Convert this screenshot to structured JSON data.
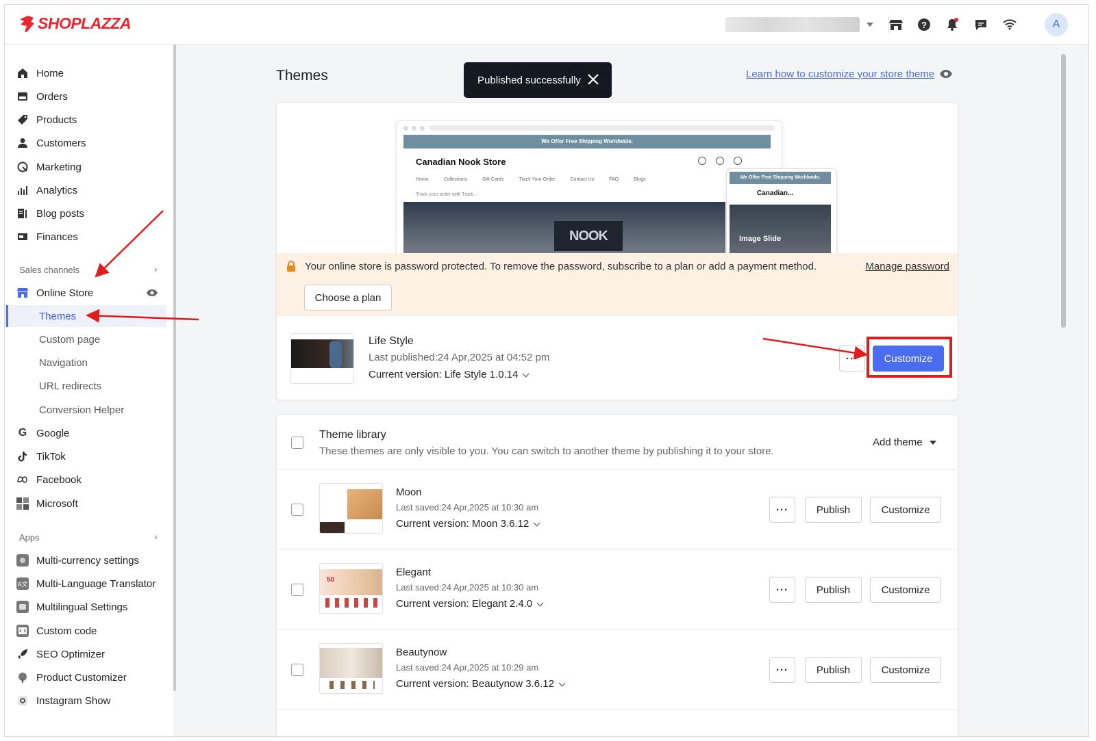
{
  "brand": {
    "name": "SHOPLAZZA",
    "color": "#e8262b"
  },
  "header": {
    "icons": [
      "store-icon",
      "help-icon",
      "bell-icon",
      "chat-icon",
      "wifi-icon"
    ],
    "avatar": "A"
  },
  "sidebar": {
    "items": [
      {
        "label": "Home",
        "icon": "home-icon"
      },
      {
        "label": "Orders",
        "icon": "orders-icon"
      },
      {
        "label": "Products",
        "icon": "tag-icon"
      },
      {
        "label": "Customers",
        "icon": "person-icon"
      },
      {
        "label": "Marketing",
        "icon": "marketing-icon"
      },
      {
        "label": "Analytics",
        "icon": "analytics-icon"
      },
      {
        "label": "Blog posts",
        "icon": "blog-icon"
      },
      {
        "label": "Finances",
        "icon": "finances-icon"
      }
    ],
    "sales_channels_title": "Sales channels",
    "online_store": "Online Store",
    "sub_items": [
      "Themes",
      "Custom page",
      "Navigation",
      "URL redirects",
      "Conversion Helper"
    ],
    "channels": [
      {
        "label": "Google",
        "icon": "google-icon"
      },
      {
        "label": "TikTok",
        "icon": "tiktok-icon"
      },
      {
        "label": "Facebook",
        "icon": "meta-icon"
      },
      {
        "label": "Microsoft",
        "icon": "microsoft-icon"
      }
    ],
    "apps_title": "Apps",
    "apps": [
      {
        "label": "Multi-currency settings",
        "icon": "currency-app-icon"
      },
      {
        "label": "Multi-Language Translator",
        "icon": "translator-app-icon"
      },
      {
        "label": "Multilingual Settings",
        "icon": "multilingual-app-icon"
      },
      {
        "label": "Custom code",
        "icon": "code-app-icon"
      },
      {
        "label": "SEO Optimizer",
        "icon": "rocket-app-icon"
      },
      {
        "label": "Product Customizer",
        "icon": "customizer-app-icon"
      },
      {
        "label": "Instagram Show",
        "icon": "instagram-app-icon"
      }
    ]
  },
  "page": {
    "title": "Themes",
    "toast": "Published successfully",
    "learn_link": "Learn how to customize your store theme"
  },
  "preview": {
    "banner": "We Offer Free Shipping Worldwide.",
    "store_name": "Canadian Nook Store",
    "nav": [
      "Home",
      "Collections",
      "Gift Cards",
      "Track Your Order",
      "Contact Us",
      "FAQ",
      "Blogs"
    ],
    "track": "Track your order with Track...",
    "hero_sign": "NOOK STORE",
    "mobile_title": "Canadian...",
    "mobile_hero": "Image Slide"
  },
  "warning": {
    "text": "Your online store is password protected. To remove the password, subscribe to a plan or add a payment method.",
    "link": "Manage password",
    "button": "Choose a plan"
  },
  "current_theme": {
    "name": "Life Style",
    "last_published": "Last published:24 Apr,2025 at 04:52 pm",
    "version": "Current version: Life Style 1.0.14",
    "more": "···",
    "customize": "Customize"
  },
  "library": {
    "title": "Theme library",
    "subtitle": "These themes are only visible to you. You can switch to another theme by publishing it to your store.",
    "add_theme": "Add theme",
    "themes": [
      {
        "name": "Moon",
        "saved": "Last saved:24 Apr,2025 at 10:30 am",
        "version": "Current version: Moon 3.6.12"
      },
      {
        "name": "Elegant",
        "saved": "Last saved:24 Apr,2025 at 10:30 am",
        "version": "Current version: Elegant 2.4.0"
      },
      {
        "name": "Beautynow",
        "saved": "Last saved:24 Apr,2025 at 10:29 am",
        "version": "Current version: Beautynow 3.6.12"
      }
    ],
    "more": "···",
    "publish": "Publish",
    "customize": "Customize"
  },
  "colors": {
    "accent": "#4a6cf0",
    "annotation": "#e01c1c",
    "warning_bg": "#fdf1e4"
  }
}
